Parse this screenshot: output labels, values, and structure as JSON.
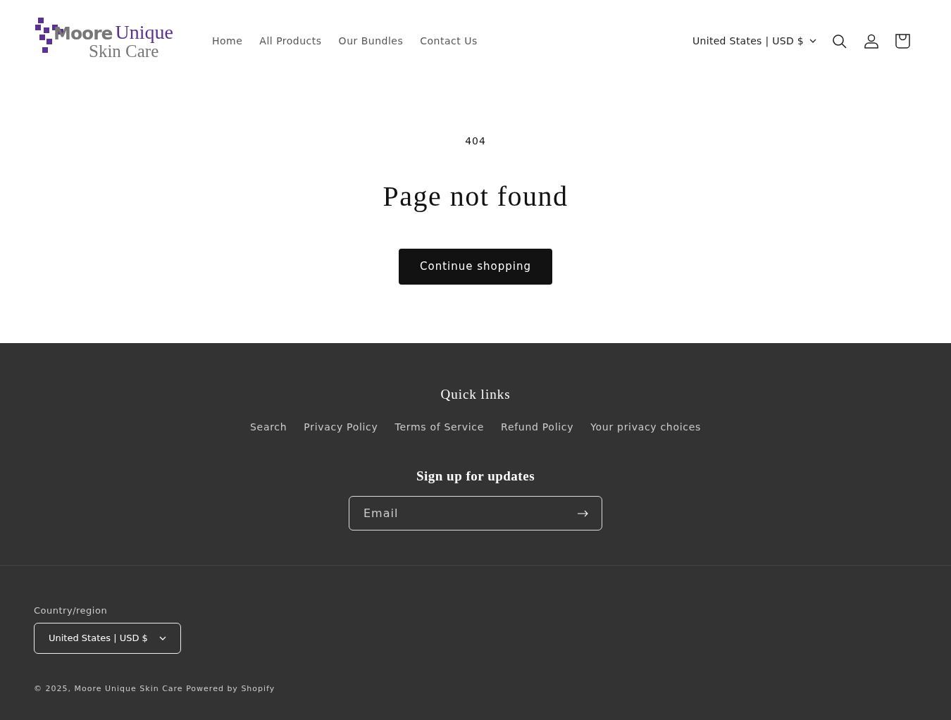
{
  "header": {
    "logo": {
      "word_1": "Moore",
      "word_2": "Unique",
      "line_2": "Skin Care"
    },
    "nav": [
      {
        "label": "Home"
      },
      {
        "label": "All Products"
      },
      {
        "label": "Our Bundles"
      },
      {
        "label": "Contact Us"
      }
    ],
    "country_selector": "United States | USD $"
  },
  "main": {
    "code": "404",
    "title": "Page not found",
    "button": "Continue shopping"
  },
  "footer": {
    "quick_links_title": "Quick links",
    "links": [
      {
        "label": "Search"
      },
      {
        "label": "Privacy Policy"
      },
      {
        "label": "Terms of Service"
      },
      {
        "label": "Refund Policy"
      },
      {
        "label": "Your privacy choices"
      }
    ],
    "signup_title": "Sign up for updates",
    "email": {
      "placeholder": "Email"
    },
    "country_label": "Country/region",
    "country_selector": "United States | USD $",
    "copyright": "© 2025,",
    "store_link": "Moore Unique Skin Care",
    "powered": "Powered by Shopify"
  }
}
